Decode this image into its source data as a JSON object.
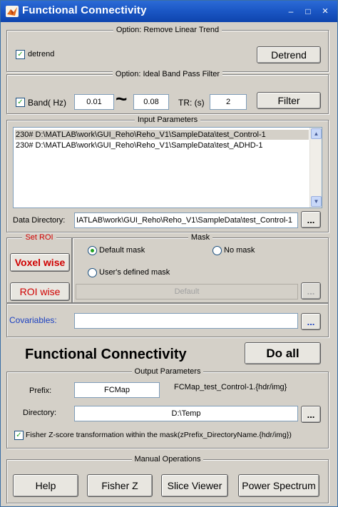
{
  "window": {
    "title": "Functional Connectivity",
    "minimize": "–",
    "maximize": "□",
    "close": "×"
  },
  "detrend_panel": {
    "title": "Option: Remove Linear Trend",
    "checkbox_label": "detrend",
    "checked": true,
    "button": "Detrend"
  },
  "filter_panel": {
    "title": "Option: Ideal Band Pass Filter",
    "checkbox_label": "Band( Hz)",
    "checked": true,
    "low": "0.01",
    "tilde": "~",
    "high": "0.08",
    "tr_label": "TR: (s)",
    "tr_value": "2",
    "button": "Filter"
  },
  "input_panel": {
    "title": "Input Parameters",
    "items": [
      "230# D:\\MATLAB\\work\\GUI_Reho\\Reho_V1\\SampleData\\test_Control-1",
      "230# D:\\MATLAB\\work\\GUI_Reho\\Reho_V1\\SampleData\\test_ADHD-1"
    ],
    "data_dir_label": "Data Directory:",
    "data_dir_value": "IATLAB\\work\\GUI_Reho\\Reho_V1\\SampleData\\test_Control-1",
    "browse": "..."
  },
  "roi": {
    "title": "Set ROI",
    "voxel_wise": "Voxel wise",
    "roi_wise": "ROI wise"
  },
  "mask": {
    "title": "Mask",
    "default_mask": "Default mask",
    "no_mask": "No mask",
    "user_mask": "User's defined mask",
    "selected": "default",
    "field_value": "Default",
    "browse": "..."
  },
  "covariables": {
    "label": "Covariables:",
    "value": "",
    "browse": "..."
  },
  "main": {
    "headline": "Functional Connectivity",
    "do_all": "Do all"
  },
  "output_panel": {
    "title": "Output Parameters",
    "prefix_label": "Prefix:",
    "prefix_value": "FCMap",
    "prefix_preview": "FCMap_test_Control-1.{hdr/img}",
    "dir_label": "Directory:",
    "dir_value": "D:\\Temp",
    "browse": "...",
    "fisher_checked": true,
    "fisher_label": "Fisher Z-score transformation within the mask(zPrefix_DirectoryName.{hdr/img})"
  },
  "manual_panel": {
    "title": "Manual Operations",
    "buttons": [
      "Help",
      "Fisher Z",
      "Slice Viewer",
      "Power Spectrum"
    ]
  },
  "colors": {
    "title_bar": "#1a56c4",
    "face": "#d4d0c8",
    "red": "#d00000",
    "blue": "#1a3fc0",
    "check": "#21a121"
  }
}
